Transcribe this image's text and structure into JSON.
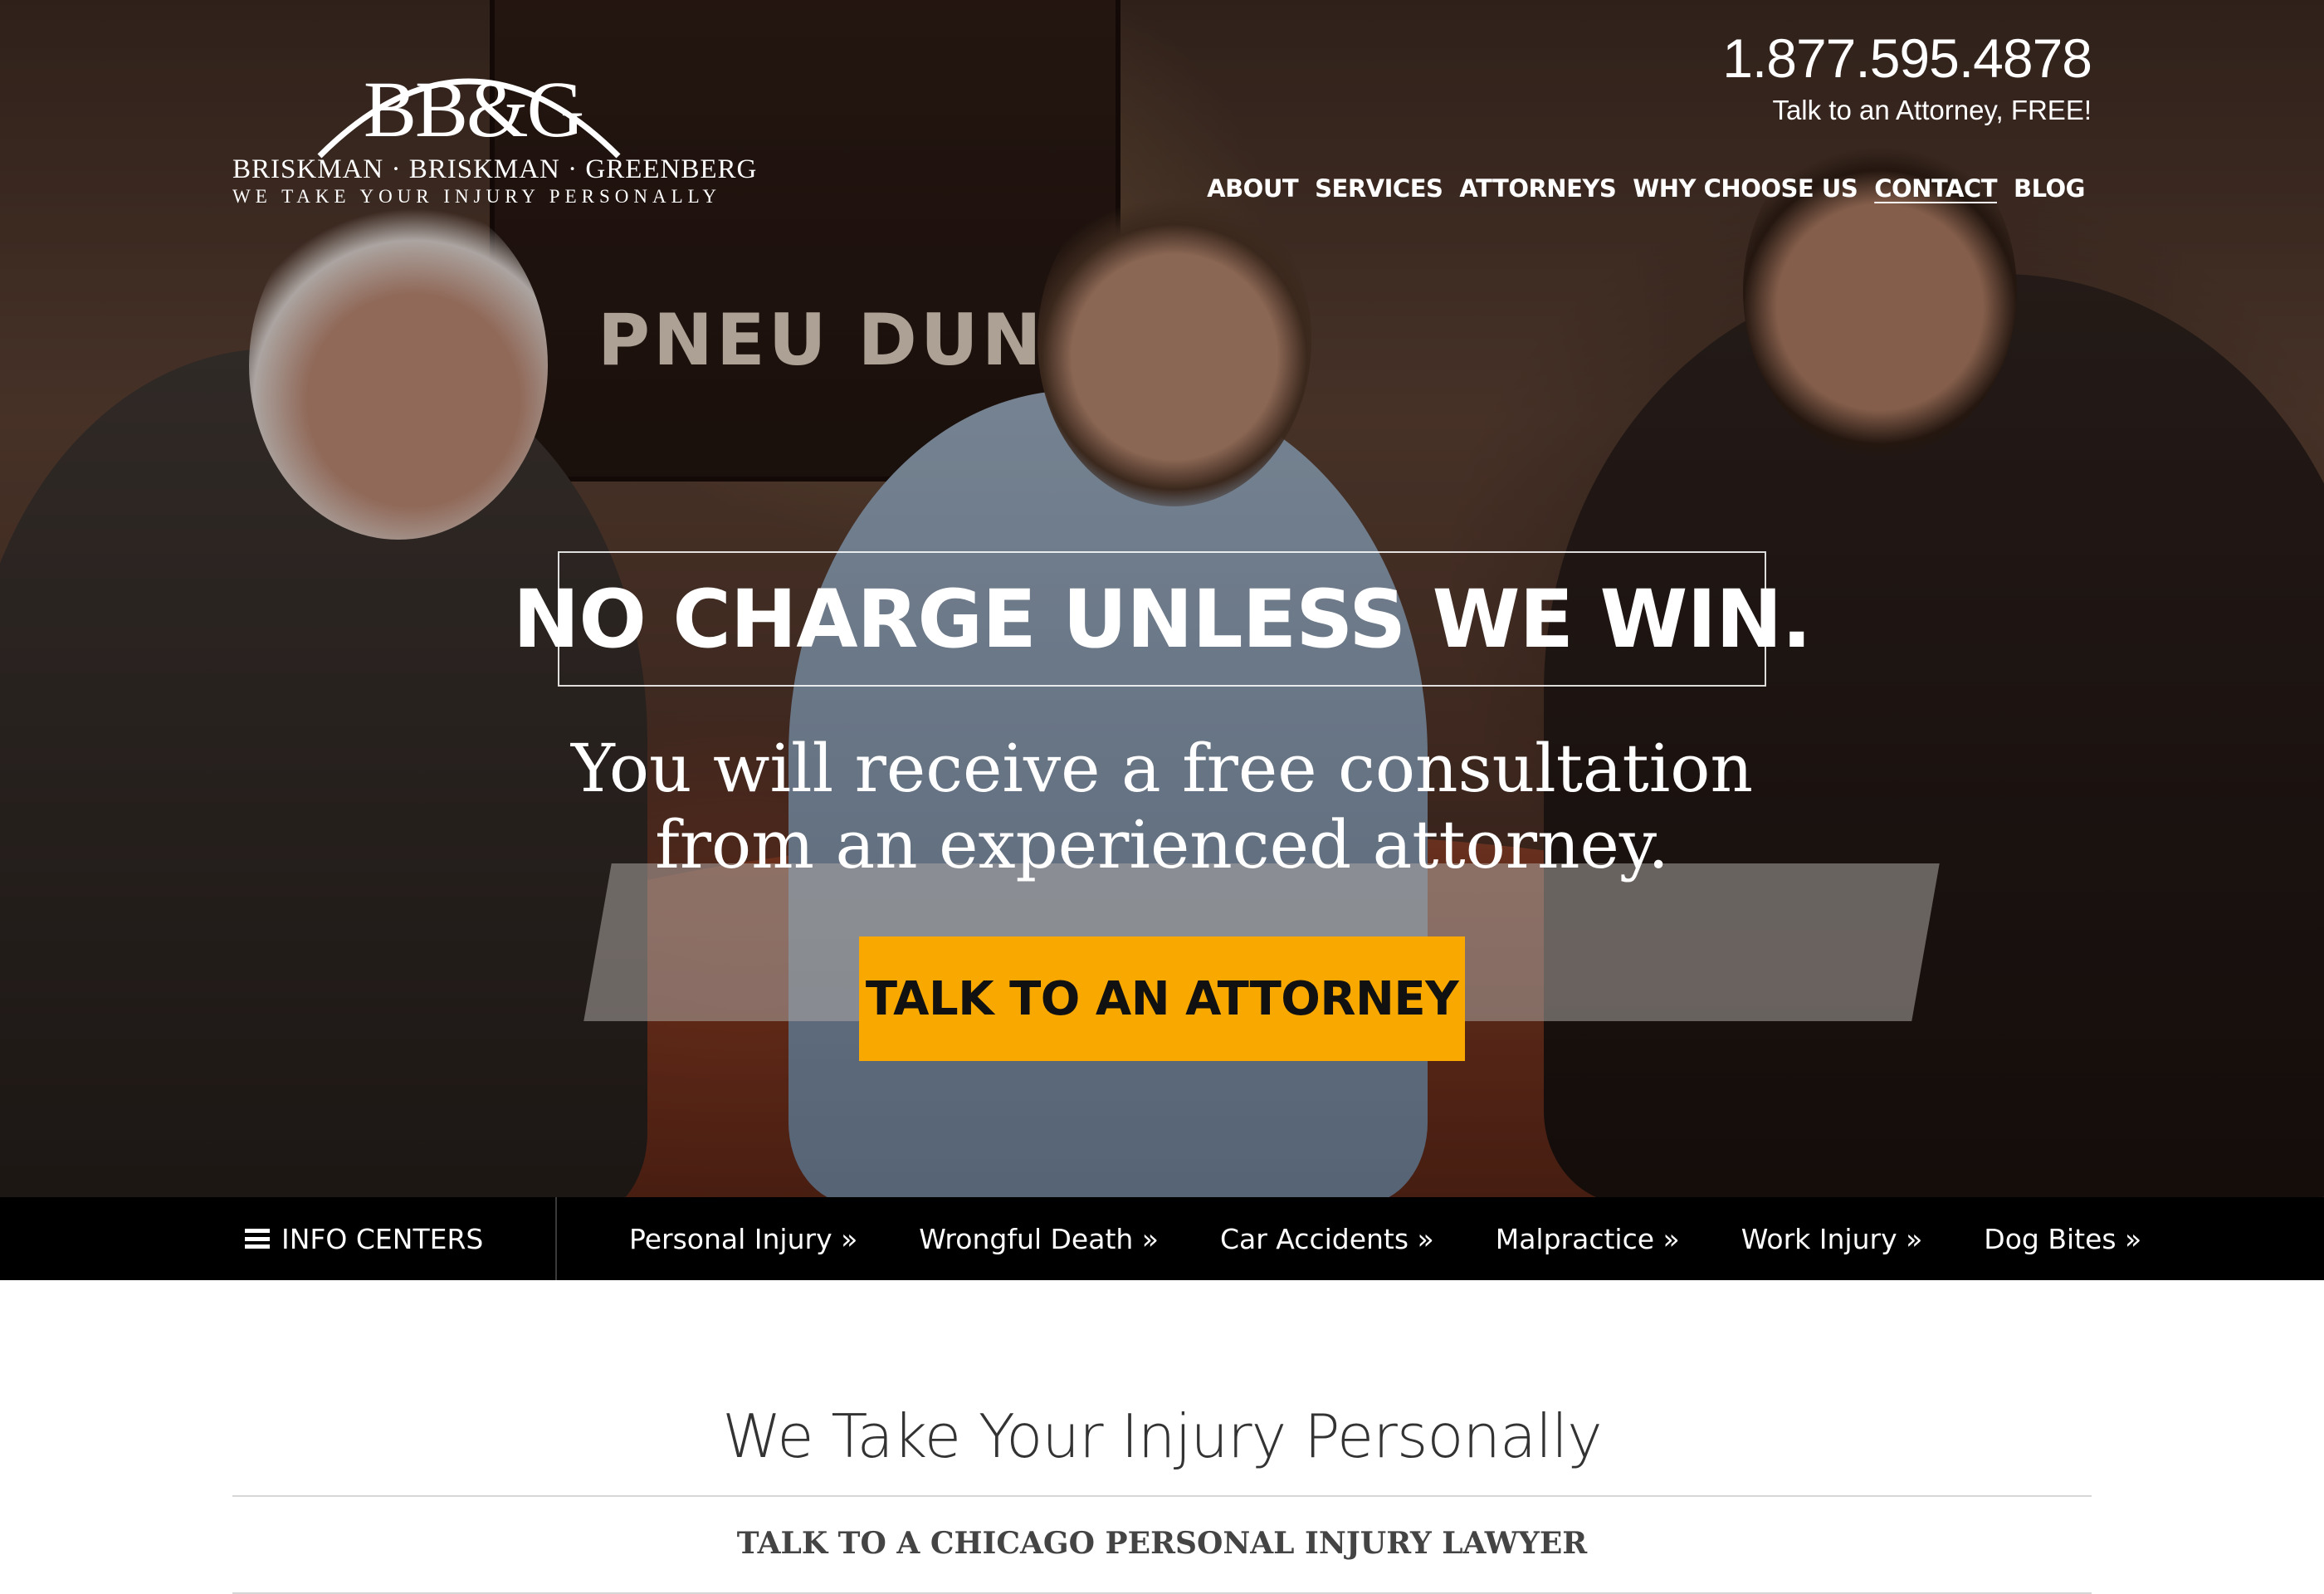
{
  "brand": {
    "mark": "BB&G",
    "name": "BRISKMAN · BRISKMAN · GREENBERG",
    "tagline": "WE TAKE YOUR INJURY PERSONALLY"
  },
  "header": {
    "phone": "1.877.595.4878",
    "phone_sub": "Talk to an Attorney, FREE!"
  },
  "nav": {
    "items": [
      {
        "label": "ABOUT",
        "active": false
      },
      {
        "label": "SERVICES",
        "active": false
      },
      {
        "label": "ATTORNEYS",
        "active": false
      },
      {
        "label": "WHY CHOOSE US",
        "active": false
      },
      {
        "label": "CONTACT",
        "active": true
      },
      {
        "label": "BLOG",
        "active": false
      }
    ]
  },
  "hero": {
    "poster_text": "PNEU DUNLOP",
    "headline": "NO CHARGE UNLESS WE WIN.",
    "subhead_line1": "You will receive a free consultation",
    "subhead_line2": "from an experienced attorney.",
    "cta_label": "TALK TO AN ATTORNEY"
  },
  "infobar": {
    "menu_label": "INFO CENTERS",
    "menu_icon": "hamburger-menu-icon",
    "links": [
      "Personal Injury »",
      "Wrongful Death »",
      "Car Accidents »",
      "Malpractice »",
      "Work Injury »",
      "Dog Bites »"
    ]
  },
  "content": {
    "title": "We Take Your Injury Personally",
    "subtitle": "TALK TO A CHICAGO PERSONAL INJURY LAWYER"
  },
  "colors": {
    "cta": "#f9a800",
    "infobar": "#000000",
    "text_dark": "#333333"
  }
}
